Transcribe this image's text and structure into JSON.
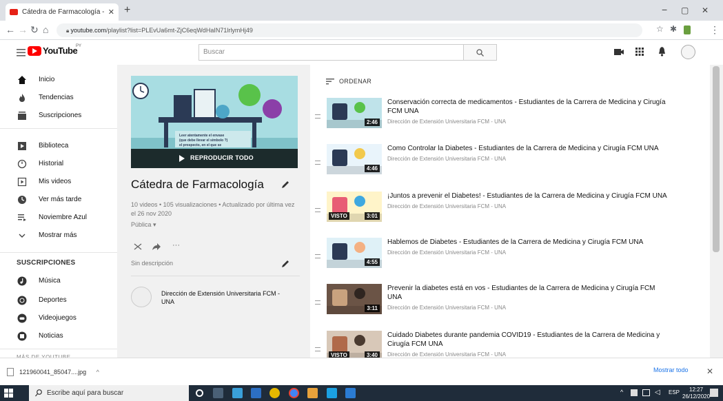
{
  "browser": {
    "tab_title": "Cátedra de Farmacología - YouT...",
    "tab_close": "✕",
    "new_tab": "+",
    "url_host": "youtube.com",
    "url_path": "/playlist?list=PLEvUa6mt-ZjC6eqWdHaIN71lrlymHj49",
    "win_min": "−",
    "win_max": "▢",
    "win_close": "✕"
  },
  "masthead": {
    "logo_text": "YouTube",
    "logo_sup": "PY",
    "search_placeholder": "Buscar"
  },
  "sidebar": {
    "items": [
      {
        "label": "Inicio",
        "icon": "home-icon"
      },
      {
        "label": "Tendencias",
        "icon": "flame-icon"
      },
      {
        "label": "Suscripciones",
        "icon": "subscriptions-icon"
      },
      {
        "label": "Biblioteca",
        "icon": "library-icon"
      },
      {
        "label": "Historial",
        "icon": "history-icon"
      },
      {
        "label": "Mis videos",
        "icon": "my-videos-icon"
      },
      {
        "label": "Ver más tarde",
        "icon": "clock-icon"
      },
      {
        "label": "Noviembre Azul",
        "icon": "playlist-icon"
      },
      {
        "label": "Mostrar más",
        "icon": "chevron-down-icon"
      }
    ],
    "subscriptions_title": "SUSCRIPCIONES",
    "subscriptions": [
      {
        "label": "Música",
        "icon": "music-icon"
      },
      {
        "label": "Deportes",
        "icon": "sports-icon"
      },
      {
        "label": "Videojuegos",
        "icon": "gaming-icon"
      },
      {
        "label": "Noticias",
        "icon": "news-icon"
      }
    ],
    "more_title": "MÁS DE YOUTUBE"
  },
  "playlist": {
    "play_all": "REPRODUCIR TODO",
    "title": "Cátedra de Farmacología",
    "stats": "10 videos • 105 visualizaciones • Actualizado por última vez el 26 nov 2020",
    "privacy": "Pública ▾",
    "description": "Sin descripción",
    "owner": "Dirección de Extensión Universitaria FCM - UNA",
    "more_dots": "···"
  },
  "list": {
    "sort_label": "ORDENAR",
    "videos": [
      {
        "title": "Conservación correcta de medicamentos - Estudiantes de la Carrera de Medicina y Cirugía FCM UNA",
        "channel": "Dirección de Extensión Universitaria FCM - UNA",
        "duration": "2:46",
        "watched": ""
      },
      {
        "title": "Como Controlar la Diabetes - Estudiantes de la Carrera de Medicina y Cirugía FCM UNA",
        "channel": "Dirección de Extensión Universitaria FCM - UNA",
        "duration": "4:46",
        "watched": ""
      },
      {
        "title": "¡Juntos a prevenir el Diabetes! - Estudiantes de la Carrera de Medicina y Cirugía FCM UNA",
        "channel": "Dirección de Extensión Universitaria FCM - UNA",
        "duration": "3:01",
        "watched": "VISTO"
      },
      {
        "title": "Hablemos de Diabetes - Estudiantes de la Carrera de Medicina y Cirugía FCM UNA",
        "channel": "Dirección de Extensión Universitaria FCM - UNA",
        "duration": "4:55",
        "watched": ""
      },
      {
        "title": "Prevenir la diabetes está en vos - Estudiantes de la Carrera de Medicina y Cirugía FCM UNA",
        "channel": "Dirección de Extensión Universitaria FCM - UNA",
        "duration": "3:11",
        "watched": ""
      },
      {
        "title": "Cuidado Diabetes durante pandemia COVID19 - Estudiantes de la Carrera de Medicina y Cirugía FCM UNA",
        "channel": "Dirección de Extensión Universitaria FCM - UNA",
        "duration": "3:40",
        "watched": "VISTO"
      }
    ]
  },
  "downloads": {
    "file": "121960041_85047....jpg",
    "caret": "^",
    "show_all": "Mostrar todo",
    "close": "✕"
  },
  "taskbar": {
    "search_placeholder": "Escribe aquí para buscar",
    "lang": "ESP",
    "time": "12:27",
    "date": "26/12/2020"
  },
  "colors": {
    "yt_red": "#ff0000",
    "link_blue": "#1a73e8",
    "taskbar": "#1f2c3a"
  }
}
